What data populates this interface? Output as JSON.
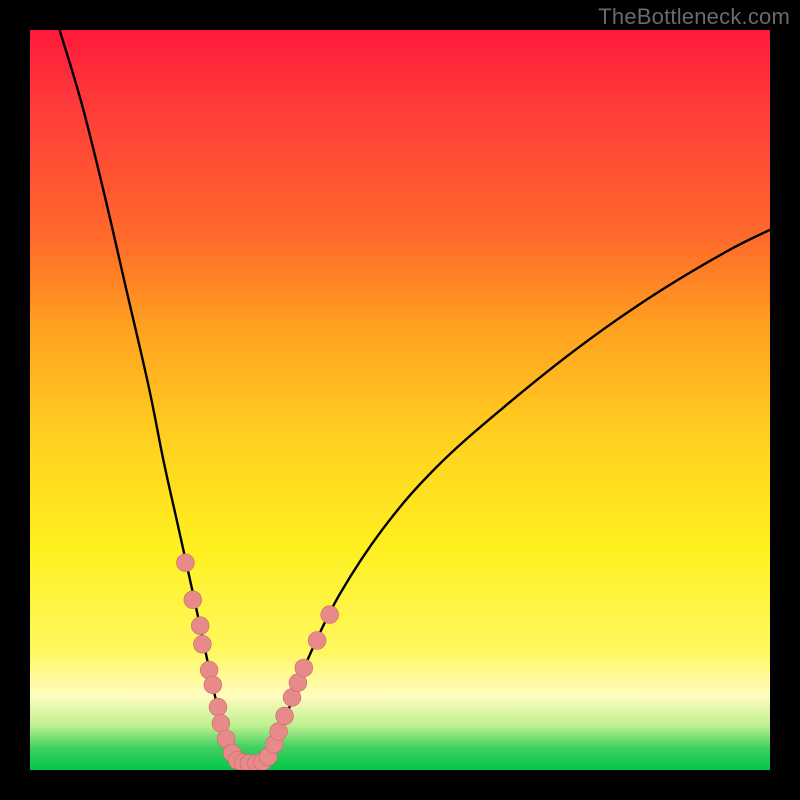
{
  "watermark": {
    "text": "TheBottleneck.com"
  },
  "colors": {
    "curve": "#000000",
    "marker_fill": "#e88a8a",
    "marker_stroke": "#c86a6a"
  },
  "chart_data": {
    "type": "line",
    "title": "",
    "xlabel": "",
    "ylabel": "",
    "xlim": [
      0,
      100
    ],
    "ylim": [
      0,
      100
    ],
    "curve": {
      "note": "Two monotone branches that meet at a flat near-zero minimum. Values are percent of plot area: x left→right, y bottom→top.",
      "left_branch": [
        {
          "x": 4,
          "y": 100
        },
        {
          "x": 7,
          "y": 90
        },
        {
          "x": 10,
          "y": 78
        },
        {
          "x": 13,
          "y": 65
        },
        {
          "x": 16,
          "y": 52
        },
        {
          "x": 18,
          "y": 42
        },
        {
          "x": 20,
          "y": 33
        },
        {
          "x": 22,
          "y": 24
        },
        {
          "x": 23.5,
          "y": 17
        },
        {
          "x": 25,
          "y": 10
        },
        {
          "x": 26,
          "y": 5.5
        },
        {
          "x": 27,
          "y": 2.5
        },
        {
          "x": 28,
          "y": 1.2
        },
        {
          "x": 29,
          "y": 0.8
        }
      ],
      "right_branch": [
        {
          "x": 31,
          "y": 0.8
        },
        {
          "x": 32,
          "y": 1.5
        },
        {
          "x": 33,
          "y": 3.5
        },
        {
          "x": 34.5,
          "y": 7
        },
        {
          "x": 36,
          "y": 11
        },
        {
          "x": 38,
          "y": 16
        },
        {
          "x": 42,
          "y": 24
        },
        {
          "x": 48,
          "y": 33
        },
        {
          "x": 55,
          "y": 41
        },
        {
          "x": 64,
          "y": 49
        },
        {
          "x": 74,
          "y": 57
        },
        {
          "x": 84,
          "y": 64
        },
        {
          "x": 94,
          "y": 70
        },
        {
          "x": 100,
          "y": 73
        }
      ]
    },
    "markers": {
      "note": "Round pink markers overlaid near the low portion of both branches.",
      "r_pct": 1.2,
      "points": [
        {
          "x": 21,
          "y": 28
        },
        {
          "x": 22,
          "y": 23
        },
        {
          "x": 23,
          "y": 19.5
        },
        {
          "x": 23.3,
          "y": 17
        },
        {
          "x": 24.2,
          "y": 13.5
        },
        {
          "x": 24.7,
          "y": 11.5
        },
        {
          "x": 25.4,
          "y": 8.5
        },
        {
          "x": 25.8,
          "y": 6.3
        },
        {
          "x": 26.5,
          "y": 4.2
        },
        {
          "x": 27.3,
          "y": 2.3
        },
        {
          "x": 28,
          "y": 1.3
        },
        {
          "x": 28.8,
          "y": 1.0
        },
        {
          "x": 29.6,
          "y": 0.9
        },
        {
          "x": 30.6,
          "y": 0.9
        },
        {
          "x": 31.4,
          "y": 1.1
        },
        {
          "x": 32.2,
          "y": 1.8
        },
        {
          "x": 33,
          "y": 3.5
        },
        {
          "x": 33.6,
          "y": 5.2
        },
        {
          "x": 34.4,
          "y": 7.3
        },
        {
          "x": 35.4,
          "y": 9.8
        },
        {
          "x": 36.2,
          "y": 11.8
        },
        {
          "x": 37,
          "y": 13.8
        },
        {
          "x": 38.8,
          "y": 17.5
        },
        {
          "x": 40.5,
          "y": 21
        }
      ]
    }
  }
}
